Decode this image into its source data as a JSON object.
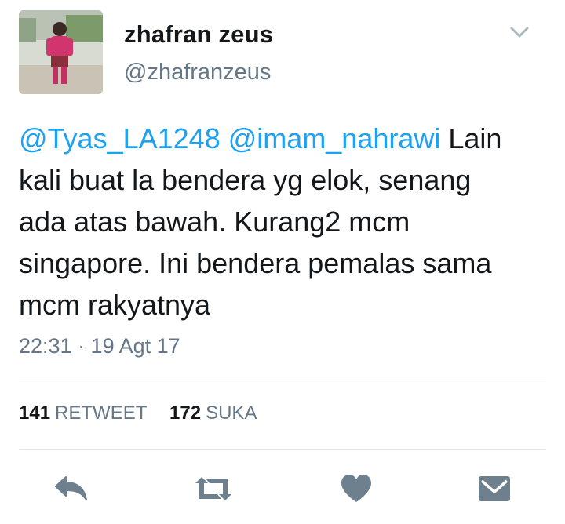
{
  "user": {
    "display_name": "zhafran zeus",
    "handle": "@zhafranzeus"
  },
  "tweet": {
    "lines": [
      {
        "mention1": "@Tyas_LA1248",
        "mention2": "@imam_nahrawi",
        "rest": " Lain"
      },
      {
        "text": "kali buat la bendera yg elok, senang"
      },
      {
        "text": "ada atas bawah. Kurang2 mcm"
      },
      {
        "text": "singapore. Ini bendera pemalas sama"
      },
      {
        "text": "mcm rakyatnya"
      }
    ],
    "timestamp": "22:31 · 19 Agt 17"
  },
  "stats": {
    "retweet_count": "141",
    "retweet_label": "RETWEET",
    "like_count": "172",
    "like_label": "SUKA"
  },
  "actions": {
    "reply_icon": "reply-icon",
    "retweet_icon": "retweet-icon",
    "like_icon": "heart-icon",
    "dm_icon": "envelope-icon"
  },
  "colors": {
    "mention": "#1da1f2",
    "secondary_text": "#657786",
    "icon": "#6e7f8d",
    "divider": "#e1e8ed"
  }
}
